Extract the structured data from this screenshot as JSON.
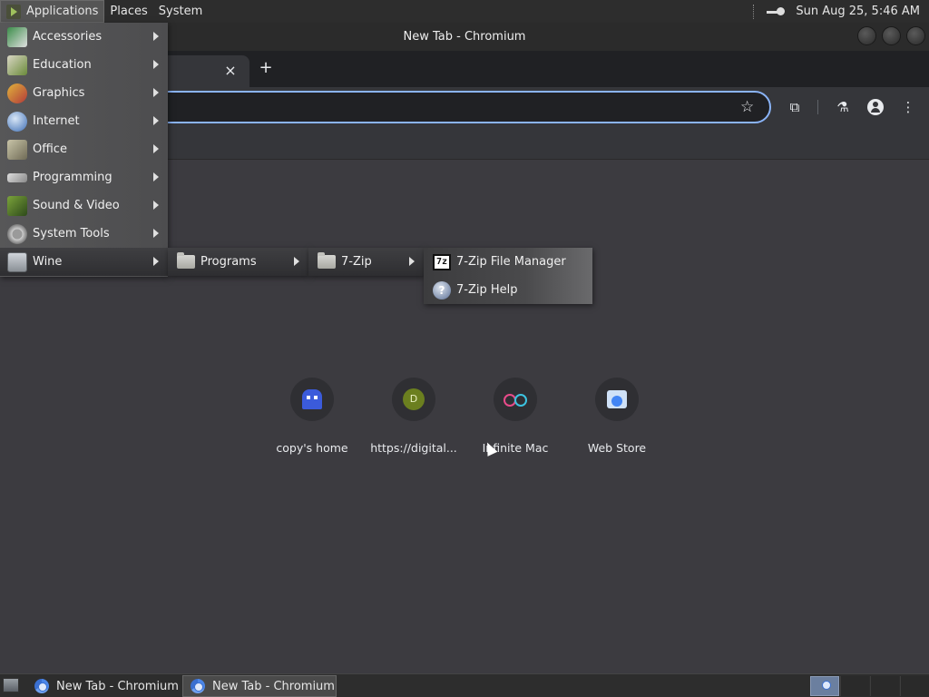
{
  "top_panel": {
    "menus": [
      "Applications",
      "Places",
      "System"
    ],
    "clock": "Sun Aug 25,  5:46 AM",
    "icons": {
      "launcher": "app-launcher-icon",
      "network": "key-icon"
    }
  },
  "window": {
    "title": "New Tab - Chromium",
    "tab_close": "×",
    "new_tab": "+"
  },
  "toolbar": {
    "star": "☆",
    "extensions": "⧉",
    "labs": "⚗",
    "menu": "⋮"
  },
  "app_menu": {
    "items": [
      {
        "label": "Accessories",
        "icon": "accessories-icon"
      },
      {
        "label": "Education",
        "icon": "education-icon"
      },
      {
        "label": "Graphics",
        "icon": "graphics-icon"
      },
      {
        "label": "Internet",
        "icon": "internet-globe-icon"
      },
      {
        "label": "Office",
        "icon": "office-icon"
      },
      {
        "label": "Programming",
        "icon": "programming-icon"
      },
      {
        "label": "Sound & Video",
        "icon": "sound-video-icon"
      },
      {
        "label": "System Tools",
        "icon": "system-tools-gear-icon"
      },
      {
        "label": "Wine",
        "icon": "wine-icon"
      }
    ],
    "highlighted": "Wine"
  },
  "submenus": {
    "programs": "Programs",
    "zip_folder": "7-Zip",
    "zip_items": [
      {
        "label": "7-Zip File Manager",
        "icon_text": "7z"
      },
      {
        "label": "7-Zip Help",
        "icon_text": "?"
      }
    ]
  },
  "ntp": {
    "shortcuts": [
      {
        "label": "copy's home",
        "icon": "ghost-icon"
      },
      {
        "label": "https://digital...",
        "icon": "letter-d-icon",
        "letter": "D"
      },
      {
        "label": "Infinite Mac",
        "icon": "glasses-icon"
      },
      {
        "label": "Web Store",
        "icon": "web-store-icon"
      }
    ]
  },
  "taskbar": {
    "tasks": [
      "New Tab - Chromium",
      "New Tab - Chromium"
    ]
  }
}
